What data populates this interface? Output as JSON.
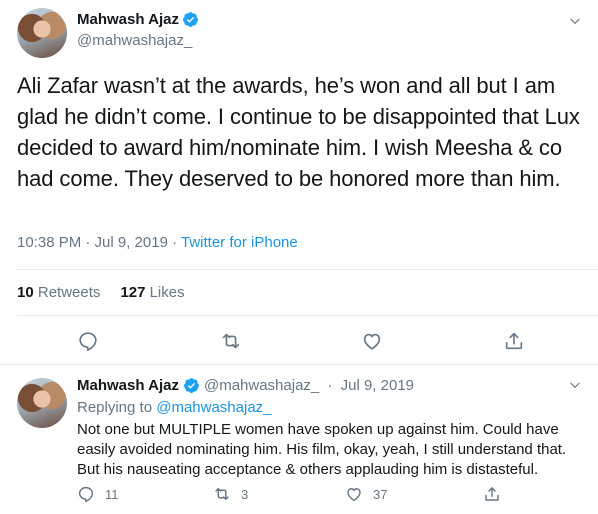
{
  "main": {
    "author_name": "Mahwash Ajaz",
    "handle": "@mahwashajaz_",
    "text": "Ali Zafar wasn’t at the awards, he’s won and all but I am glad he didn’t come. I continue to be disappointed that Lux decided to award him/nominate him. I wish Meesha & co had come. They deserved to be honored more than him.",
    "time": "10:38 PM · Jul 9, 2019",
    "separator": " · ",
    "source": "Twitter for iPhone",
    "retweets_count": "10",
    "retweets_label": "Retweets",
    "likes_count": "127",
    "likes_label": "Likes",
    "icons": [
      "reply-icon",
      "retweet-icon",
      "like-icon",
      "share-icon",
      "chevron-down-icon",
      "verified-badge-icon"
    ]
  },
  "reply": {
    "author_name": "Mahwash Ajaz",
    "handle": "@mahwashajaz_",
    "separator": " · ",
    "date": "Jul 9, 2019",
    "replying_prefix": "Replying to",
    "replying_handle": "@mahwashajaz_",
    "text": "Not one but MULTIPLE women have spoken up against him. Could have easily avoided nominating him. His film, okay, yeah, I still understand that. But his nauseating acceptance & others applauding him is distasteful.",
    "reply_count": "11",
    "retweet_count": "3",
    "like_count": "37"
  },
  "colors": {
    "text": "#14171a",
    "muted": "#657786",
    "link": "#1b95e0",
    "divider": "#e6ecf0"
  }
}
